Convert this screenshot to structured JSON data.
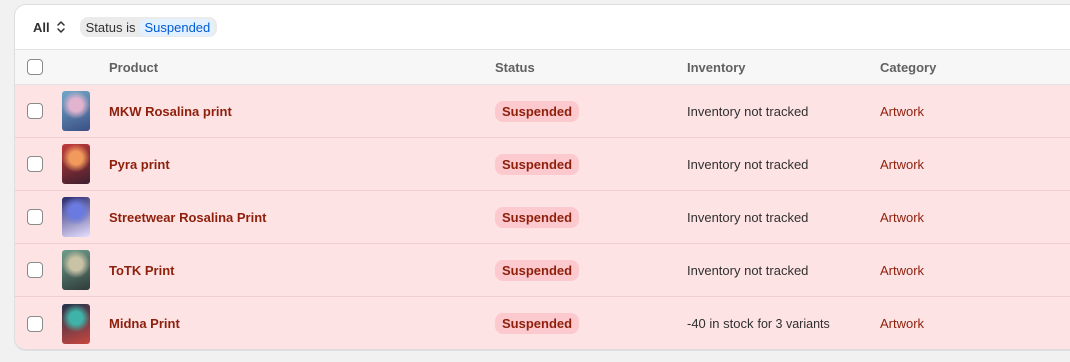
{
  "filters": {
    "view_label": "All",
    "status_filter_label": "Status is",
    "status_filter_value": "Suspended"
  },
  "table": {
    "headers": {
      "product": "Product",
      "status": "Status",
      "inventory": "Inventory",
      "category": "Category"
    },
    "rows": [
      {
        "product": "MKW Rosalina print",
        "status": "Suspended",
        "inventory": "Inventory not tracked",
        "inventory_sub": "",
        "category": "Artwork",
        "thumb_colors": [
          "#6fa8c8",
          "#e2b3cf",
          "#3b4f86"
        ]
      },
      {
        "product": "Pyra print",
        "status": "Suspended",
        "inventory": "Inventory not tracked",
        "inventory_sub": "",
        "category": "Artwork",
        "thumb_colors": [
          "#c23a3a",
          "#f29a5c",
          "#3d1f2f"
        ]
      },
      {
        "product": "Streetwear Rosalina Print",
        "status": "Suspended",
        "inventory": "Inventory not tracked",
        "inventory_sub": "",
        "category": "Artwork",
        "thumb_colors": [
          "#26286e",
          "#6a7ae0",
          "#e6e0ff"
        ]
      },
      {
        "product": "ToTK Print",
        "status": "Suspended",
        "inventory": "Inventory not tracked",
        "inventory_sub": "",
        "category": "Artwork",
        "thumb_colors": [
          "#6d9c8a",
          "#c9c2a5",
          "#2f3b3a"
        ]
      },
      {
        "product": "Midna Print",
        "status": "Suspended",
        "inventory": "-40 in stock",
        "inventory_sub": "for 3 variants",
        "category": "Artwork",
        "thumb_colors": [
          "#20324b",
          "#3fb3a8",
          "#c9463f"
        ]
      }
    ]
  },
  "colors": {
    "row_background": "#fee3e5",
    "badge_background": "#fcc9ce",
    "critical_text": "#8e1f0b",
    "filter_value_background": "#e3f1ff",
    "filter_value_text": "#005bd3"
  }
}
